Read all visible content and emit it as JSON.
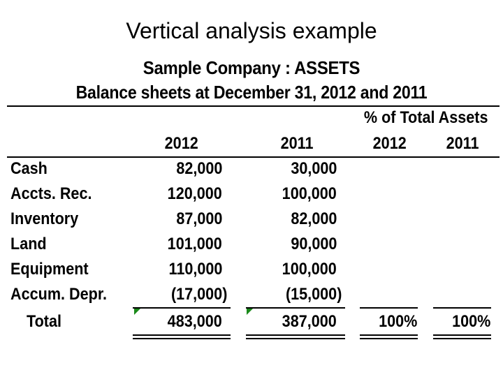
{
  "slide": {
    "title": "Vertical analysis example",
    "company_line": "Sample Company  : ASSETS",
    "period_line": "Balance sheets at December 31, 2012 and 2011"
  },
  "table": {
    "group_header": "% of Total Assets",
    "columns": [
      "2012",
      "2011",
      "2012",
      "2011"
    ],
    "rows": [
      {
        "label": "Cash",
        "y2012": "82,000",
        "y2011": "30,000",
        "pct2012": "",
        "pct2011": ""
      },
      {
        "label": "Accts. Rec.",
        "y2012": "120,000",
        "y2011": "100,000",
        "pct2012": "",
        "pct2011": ""
      },
      {
        "label": "Inventory",
        "y2012": "87,000",
        "y2011": "82,000",
        "pct2012": "",
        "pct2011": ""
      },
      {
        "label": "Land",
        "y2012": "101,000",
        "y2011": "90,000",
        "pct2012": "",
        "pct2011": ""
      },
      {
        "label": "Equipment",
        "y2012": "110,000",
        "y2011": "100,000",
        "pct2012": "",
        "pct2011": ""
      },
      {
        "label": "Accum. Depr.",
        "y2012": "(17,000)",
        "y2011": "(15,000)",
        "pct2012": "",
        "pct2011": ""
      }
    ],
    "total": {
      "label": "Total",
      "y2012": "483,000",
      "y2011": "387,000",
      "pct2012": "100%",
      "pct2011": "100%"
    }
  },
  "colors": {
    "error_indicator": "#1a8a1a"
  }
}
